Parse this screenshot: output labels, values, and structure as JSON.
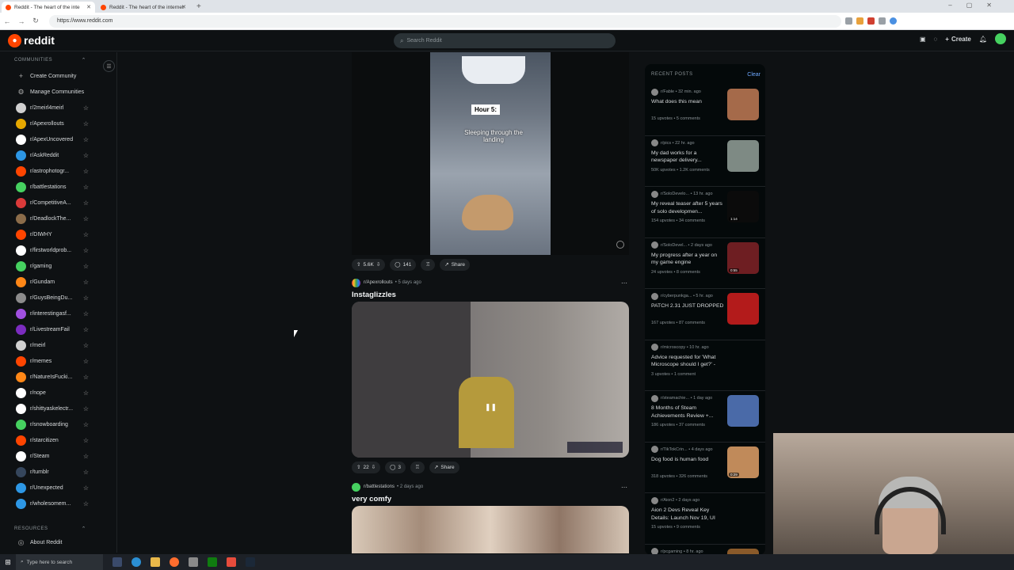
{
  "browser": {
    "tabs": [
      {
        "title": "Reddit - The heart of the inte",
        "active": true
      },
      {
        "title": "Reddit - The heart of the internet",
        "active": false
      }
    ],
    "url": "https://www.reddit.com"
  },
  "header": {
    "logo_text": "reddit",
    "search_placeholder": "Search Reddit",
    "create_label": "Create",
    "notification_count": "1"
  },
  "sidebar": {
    "communities_title": "COMMUNITIES",
    "create_community": "Create Community",
    "manage_communities": "Manage Communities",
    "communities": [
      {
        "name": "r/2meirl4meirl",
        "color": "#d0d0d0"
      },
      {
        "name": "r/Apexrollouts",
        "color": "#e6a800"
      },
      {
        "name": "r/ApexUncovered",
        "color": "#ffffff"
      },
      {
        "name": "r/AskReddit",
        "color": "#2d97e5"
      },
      {
        "name": "r/astrophotogr...",
        "color": "#ff4500"
      },
      {
        "name": "r/battlestations",
        "color": "#46d160"
      },
      {
        "name": "r/CompetitiveA...",
        "color": "#da3a3a"
      },
      {
        "name": "r/DeadlockThe...",
        "color": "#8b6c4a"
      },
      {
        "name": "r/DIWHY",
        "color": "#ff4500"
      },
      {
        "name": "r/firstworldprob...",
        "color": "#ffffff"
      },
      {
        "name": "r/gaming",
        "color": "#46d160"
      },
      {
        "name": "r/Gundam",
        "color": "#ff8717"
      },
      {
        "name": "r/GuysBeingDu...",
        "color": "#8c8c8c"
      },
      {
        "name": "r/interestingasf...",
        "color": "#a050e0"
      },
      {
        "name": "r/LivestreamFail",
        "color": "#7b2cbf"
      },
      {
        "name": "r/meirl",
        "color": "#d0d0d0"
      },
      {
        "name": "r/memes",
        "color": "#ff4500"
      },
      {
        "name": "r/NatureIsFucki...",
        "color": "#ff8717"
      },
      {
        "name": "r/nope",
        "color": "#ffffff"
      },
      {
        "name": "r/shittyaskelectr...",
        "color": "#ffffff"
      },
      {
        "name": "r/snowboarding",
        "color": "#46d160"
      },
      {
        "name": "r/starcitizen",
        "color": "#ff4500"
      },
      {
        "name": "r/Steam",
        "color": "#ffffff"
      },
      {
        "name": "r/tumblr",
        "color": "#35465c"
      },
      {
        "name": "r/Unexpected",
        "color": "#2d97e5"
      },
      {
        "name": "r/wholesomem...",
        "color": "#2d97e5"
      }
    ],
    "resources_title": "RESOURCES",
    "about_reddit": "About Reddit"
  },
  "feed": {
    "post1": {
      "hour_label": "Hour 5:",
      "caption": "Sleeping through the landing",
      "votes": "5.6K",
      "comments": "141",
      "share": "Share"
    },
    "post2": {
      "subreddit": "r/Apexrollouts",
      "time": "5 days ago",
      "title": "Instaglizzles",
      "votes": "22",
      "comments": "3",
      "share": "Share"
    },
    "post3": {
      "subreddit": "r/battlestations",
      "time": "2 days ago",
      "title": "very comfy"
    }
  },
  "recent_posts": {
    "title": "RECENT POSTS",
    "clear_label": "Clear",
    "items": [
      {
        "sub": "r/Fable",
        "time": "32 min. ago",
        "title": "What does this mean",
        "upvotes": "15 upvotes",
        "comments": "5 comments",
        "thumb": "#a56a4a"
      },
      {
        "sub": "r/pics",
        "time": "22 hr. ago",
        "title": "My dad works for a newspaper delivery...",
        "upvotes": "50K upvotes",
        "comments": "1.2K comments",
        "thumb": "#7e8a84"
      },
      {
        "sub": "r/SoloDevelo...",
        "time": "13 hr. ago",
        "title": "My reveal teaser after 5 years of solo developmen...",
        "upvotes": "154 upvotes",
        "comments": "34 comments",
        "thumb": "#0b0b0b",
        "badge": "1:14"
      },
      {
        "sub": "r/SoloDevel...",
        "time": "2 days ago",
        "title": "My progress after a year on my game engine",
        "upvotes": "24 upvotes",
        "comments": "8 comments",
        "thumb": "#6e1e22",
        "badge": "0:55"
      },
      {
        "sub": "r/cyberpunkga...",
        "time": "5 hr. ago",
        "title": "PATCH 2.31 JUST DROPPED",
        "upvotes": "167 upvotes",
        "comments": "87 comments",
        "thumb": "#b31b1b"
      },
      {
        "sub": "r/microscopy",
        "time": "10 hr. ago",
        "title": "Advice requested for 'What Microscope should I get?' - homestead/veterinary...",
        "upvotes": "3 upvotes",
        "comments": "1 comment",
        "thumb": ""
      },
      {
        "sub": "r/steamachie...",
        "time": "1 day ago",
        "title": "8 Months of Steam Achievements Review +...",
        "upvotes": "186 upvotes",
        "comments": "37 comments",
        "thumb": "#4a6aa8"
      },
      {
        "sub": "r/TikTokCrin...",
        "time": "4 days ago",
        "title": "Dog food is human food",
        "upvotes": "318 upvotes",
        "comments": "326 comments",
        "thumb": "#c08a5a",
        "badge": "0:29"
      },
      {
        "sub": "r/Aion2",
        "time": "2 days ago",
        "title": "Aion 2 Devs Reveal Key Details: Launch Nov 19, UI Changes, PvP & Monetization",
        "upvotes": "15 upvotes",
        "comments": "9 comments",
        "thumb": ""
      },
      {
        "sub": "r/pcgaming",
        "time": "8 hr. ago",
        "title": "",
        "upvotes": "",
        "comments": "",
        "thumb": "#8a5a2a"
      }
    ]
  },
  "taskbar": {
    "search_placeholder": "Type here to search"
  }
}
